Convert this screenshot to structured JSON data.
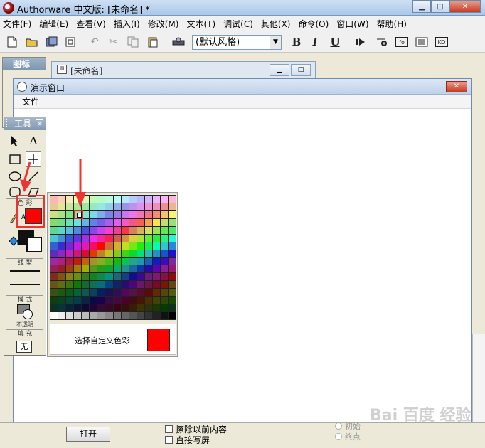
{
  "window": {
    "title": "Authorware 中文版: [未命名] *",
    "min_label": "▁",
    "max_label": "□",
    "close_label": "✕"
  },
  "menubar": {
    "items": [
      "文件(F)",
      "编辑(E)",
      "查看(V)",
      "插入(I)",
      "修改(M)",
      "文本(T)",
      "调试(C)",
      "其他(X)",
      "命令(O)",
      "窗口(W)",
      "帮助(H)"
    ]
  },
  "toolbar": {
    "style_select": "(默认风格)",
    "bold": "B",
    "italic": "I",
    "underline": "U",
    "fn_label": "fo",
    "ko_label": "KO"
  },
  "icon_panel": {
    "title": "图标"
  },
  "design_window": {
    "title": "[未命名]"
  },
  "presentation_window": {
    "title": "演示窗口",
    "menu_file": "文件"
  },
  "tools_panel": {
    "title": "工具",
    "close_label": "⊠",
    "section_color": "色 彩",
    "section_line": "线 型",
    "section_mode": "模 式",
    "mode_value": "不透明",
    "section_fill": "填 充",
    "fill_value": "无"
  },
  "palette": {
    "custom_label": "选择自定义色彩",
    "selected_color": "#ff0000"
  },
  "bottom_panel": {
    "open_button": "打开",
    "chk_erase": "擦除以前内容",
    "chk_direct": "直接写屏",
    "radio_initial": "初始",
    "radio_end": "终点"
  },
  "watermark": "Bai 百度 经验",
  "colors": {
    "accent_red": "#ff0000",
    "annotation_red": "#ee3333"
  }
}
